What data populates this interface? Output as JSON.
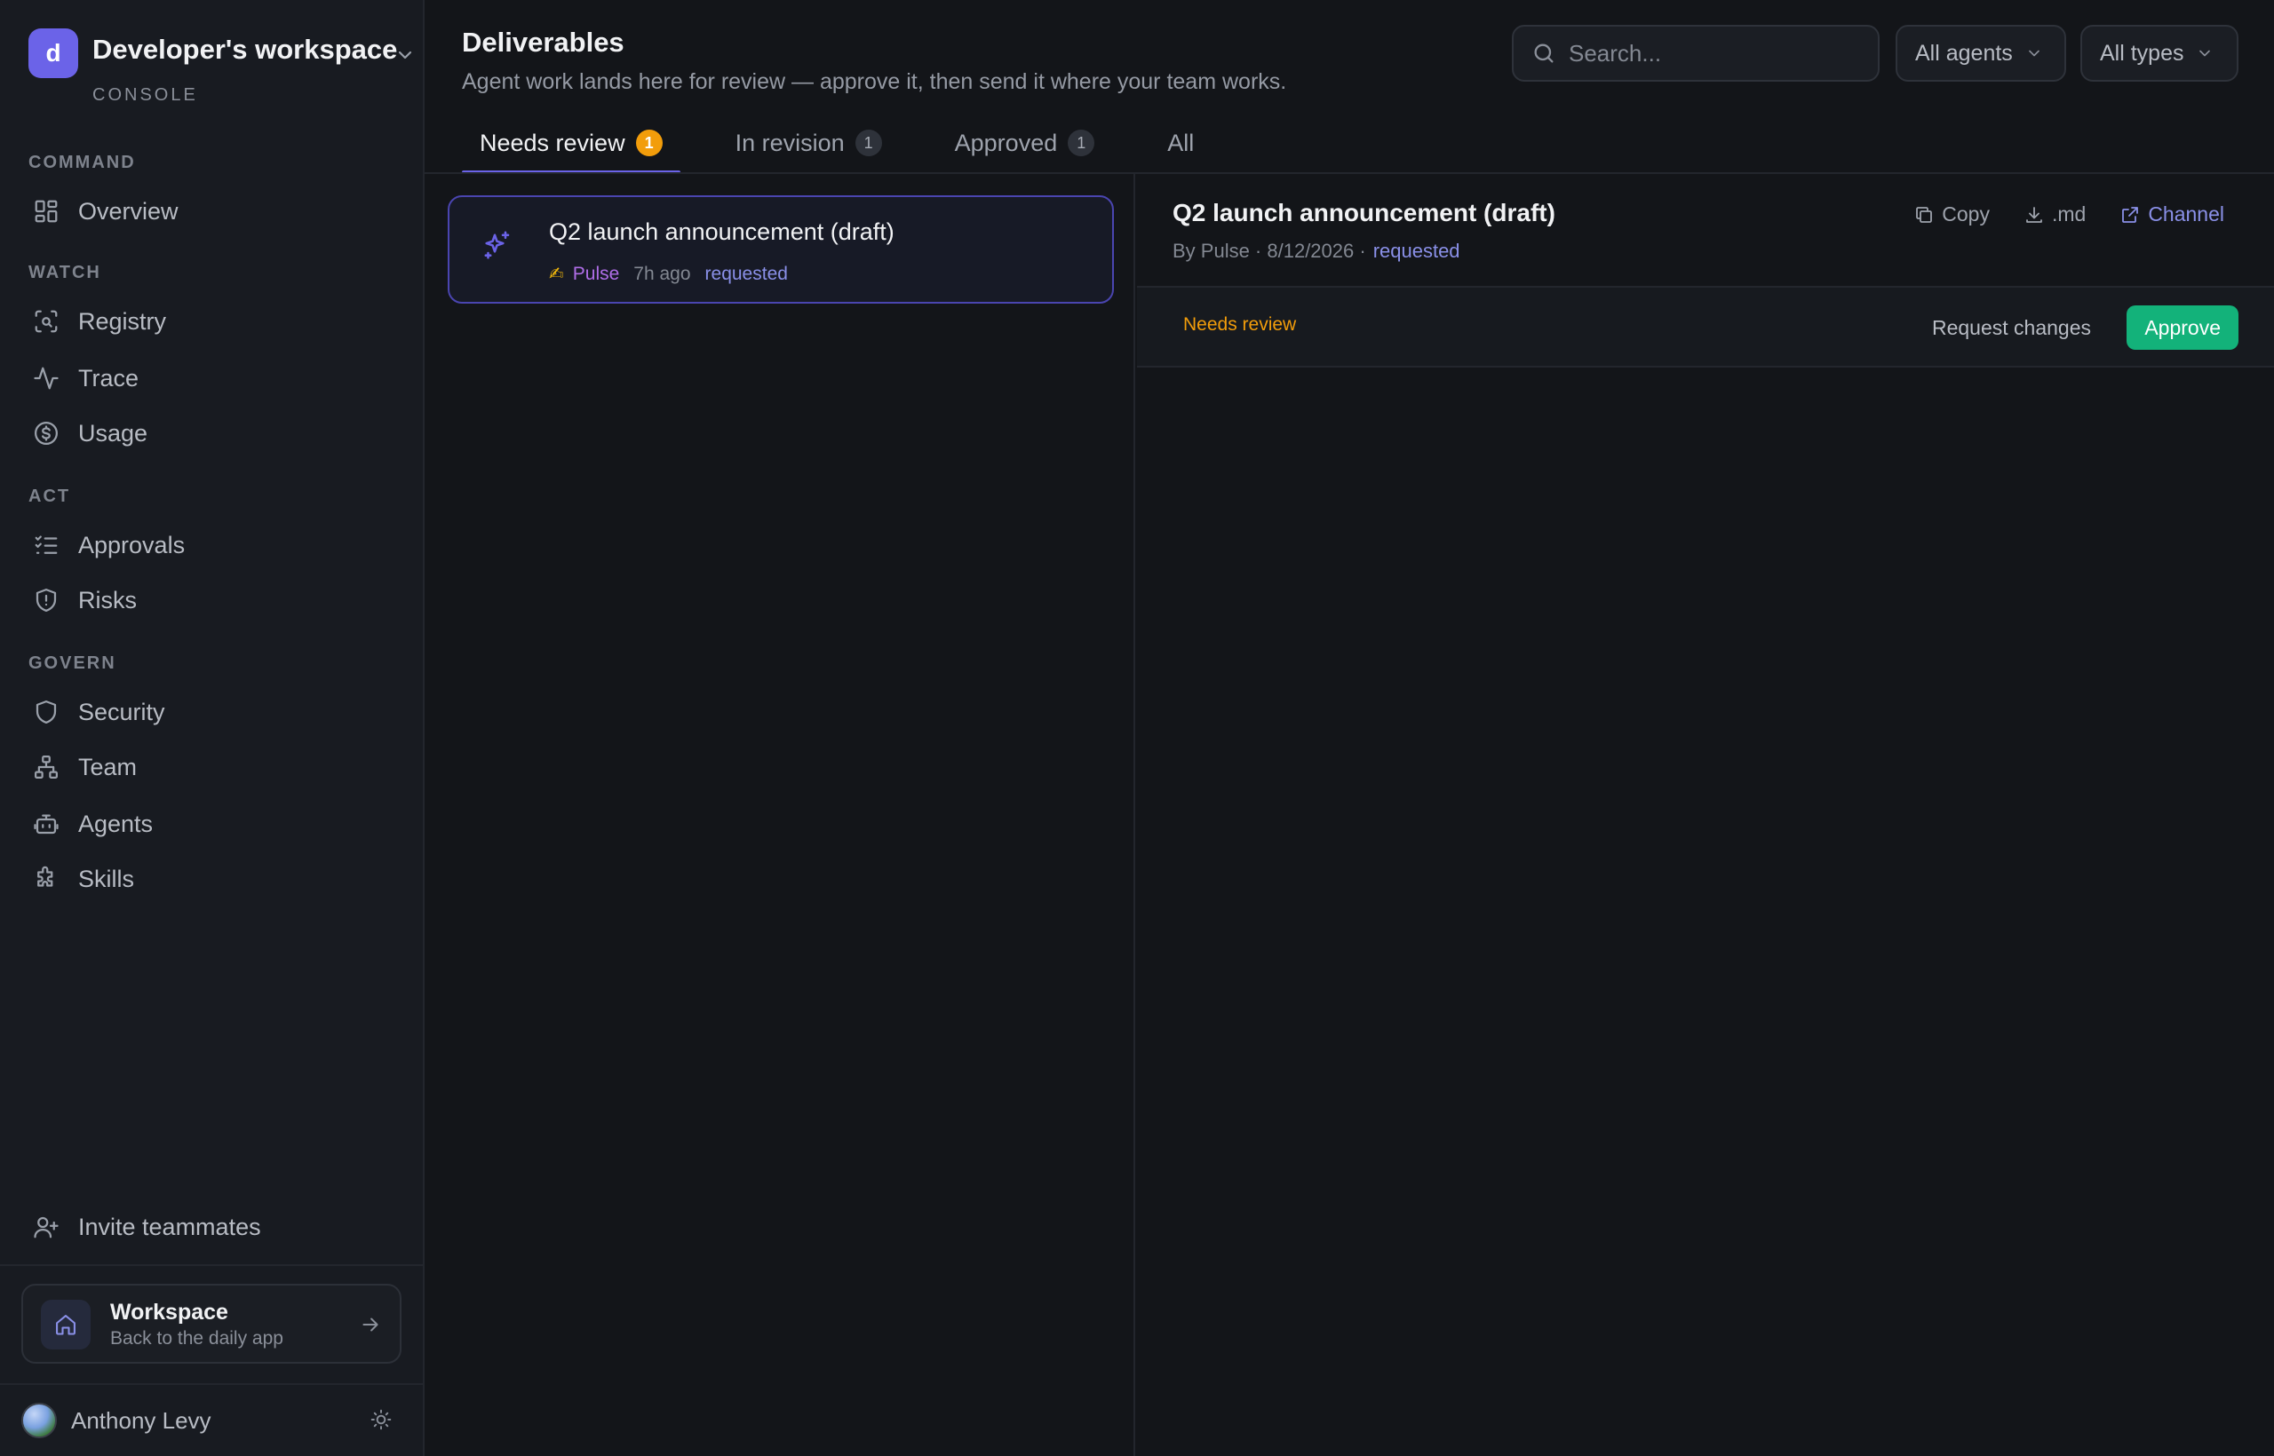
{
  "workspace": {
    "initial": "d",
    "name": "Developer's workspace",
    "subtitle": "CONSOLE"
  },
  "sidebar": {
    "sections": [
      {
        "label": "COMMAND",
        "items": [
          {
            "label": "Overview",
            "icon": "grid-icon"
          }
        ]
      },
      {
        "label": "WATCH",
        "items": [
          {
            "label": "Registry",
            "icon": "scan-icon"
          },
          {
            "label": "Trace",
            "icon": "activity-icon"
          },
          {
            "label": "Usage",
            "icon": "dollar-circle-icon"
          }
        ]
      },
      {
        "label": "ACT",
        "items": [
          {
            "label": "Approvals",
            "icon": "checklist-icon"
          },
          {
            "label": "Risks",
            "icon": "shield-alert-icon"
          }
        ]
      },
      {
        "label": "GOVERN",
        "items": [
          {
            "label": "Security",
            "icon": "shield-icon"
          },
          {
            "label": "Team",
            "icon": "org-chart-icon"
          },
          {
            "label": "Agents",
            "icon": "bot-icon"
          },
          {
            "label": "Skills",
            "icon": "puzzle-icon"
          }
        ]
      }
    ],
    "invite_label": "Invite teammates",
    "workspace_card": {
      "title": "Workspace",
      "subtitle": "Back to the daily app"
    },
    "user": {
      "name": "Anthony Levy"
    }
  },
  "header": {
    "title": "Deliverables",
    "subtitle": "Agent work lands here for review — approve it, then send it where your team works.",
    "search_placeholder": "Search...",
    "filter_agents": "All agents",
    "filter_types": "All types"
  },
  "tabs": [
    {
      "label": "Needs review",
      "count": "1",
      "active": true
    },
    {
      "label": "In revision",
      "count": "1",
      "active": false
    },
    {
      "label": "Approved",
      "count": "1",
      "active": false
    },
    {
      "label": "All",
      "count": null,
      "active": false
    }
  ],
  "list": [
    {
      "title": "Q2 launch announcement (draft)",
      "emoji": "✍",
      "agent": "Pulse",
      "ago": "7h ago",
      "status": "requested"
    }
  ],
  "detail": {
    "title": "Q2 launch announcement (draft)",
    "meta": "By Pulse · 8/12/2026 ·",
    "status": "requested",
    "actions": {
      "copy": "Copy",
      "download": ".md",
      "channel": "Channel"
    },
    "review_status": "Needs review",
    "request_changes": "Request changes",
    "approve": "Approve"
  },
  "colors": {
    "accent": "#6b63e8",
    "warning": "#f29d0b",
    "success": "#13b27a",
    "agent": "#b06ee8",
    "link": "#8a90e8"
  }
}
